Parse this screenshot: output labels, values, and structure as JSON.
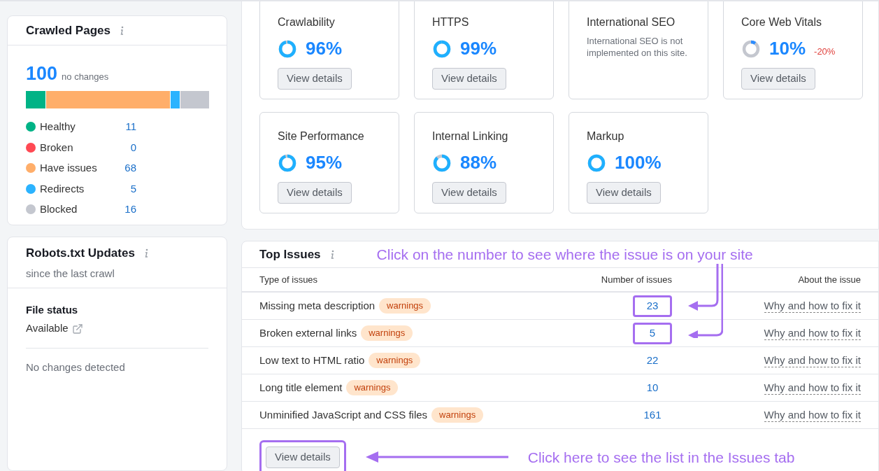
{
  "crawled_pages": {
    "title": "Crawled Pages",
    "total": "100",
    "change": "no changes",
    "legend": [
      {
        "label": "Healthy",
        "count": "11",
        "color": "#00b386"
      },
      {
        "label": "Broken",
        "count": "0",
        "color": "#ff4953"
      },
      {
        "label": "Have issues",
        "count": "68",
        "color": "#ffae6a"
      },
      {
        "label": "Redirects",
        "count": "5",
        "color": "#2bb3ff"
      },
      {
        "label": "Blocked",
        "count": "16",
        "color": "#c4c7cf"
      }
    ]
  },
  "robots": {
    "title": "Robots.txt Updates",
    "subtitle": "since the last crawl",
    "file_status_label": "File status",
    "file_status": "Available",
    "note": "No changes detected"
  },
  "score_cards": [
    {
      "kind": "score",
      "title": "Crawlability",
      "value": "96%",
      "button": "View details"
    },
    {
      "kind": "score",
      "title": "HTTPS",
      "value": "99%",
      "button": "View details"
    },
    {
      "kind": "note",
      "title": "International SEO",
      "note": "International SEO is not implemented on this site."
    },
    {
      "kind": "score",
      "title": "Core Web Vitals",
      "value": "10%",
      "change": "-20%",
      "button": "View details"
    },
    {
      "kind": "score",
      "title": "Site Performance",
      "value": "95%",
      "button": "View details"
    },
    {
      "kind": "score",
      "title": "Internal Linking",
      "value": "88%",
      "button": "View details"
    },
    {
      "kind": "score",
      "title": "Markup",
      "value": "100%",
      "button": "View details"
    }
  ],
  "top_issues": {
    "title": "Top Issues",
    "columns": [
      "Type of issues",
      "Number of issues",
      "About the issue"
    ],
    "rows": [
      {
        "type": "Missing meta description",
        "badge": "warnings",
        "count": "23",
        "highlighted": true,
        "link": "Why and how to fix it"
      },
      {
        "type": "Broken external links",
        "badge": "warnings",
        "count": "5",
        "highlighted": true,
        "link": "Why and how to fix it"
      },
      {
        "type": "Low text to HTML ratio",
        "badge": "warnings",
        "count": "22",
        "highlighted": false,
        "link": "Why and how to fix it"
      },
      {
        "type": "Long title element",
        "badge": "warnings",
        "count": "10",
        "highlighted": false,
        "link": "Why and how to fix it"
      },
      {
        "type": "Unminified JavaScript and CSS files",
        "badge": "warnings",
        "count": "161",
        "highlighted": false,
        "link": "Why and how to fix it"
      }
    ],
    "button": {
      "label": "View details",
      "highlighted": true
    }
  },
  "annotations": {
    "number_hint": "Click on the number to see where the issue is on your site",
    "details_hint": "Click here to see the list in the Issues tab"
  }
}
